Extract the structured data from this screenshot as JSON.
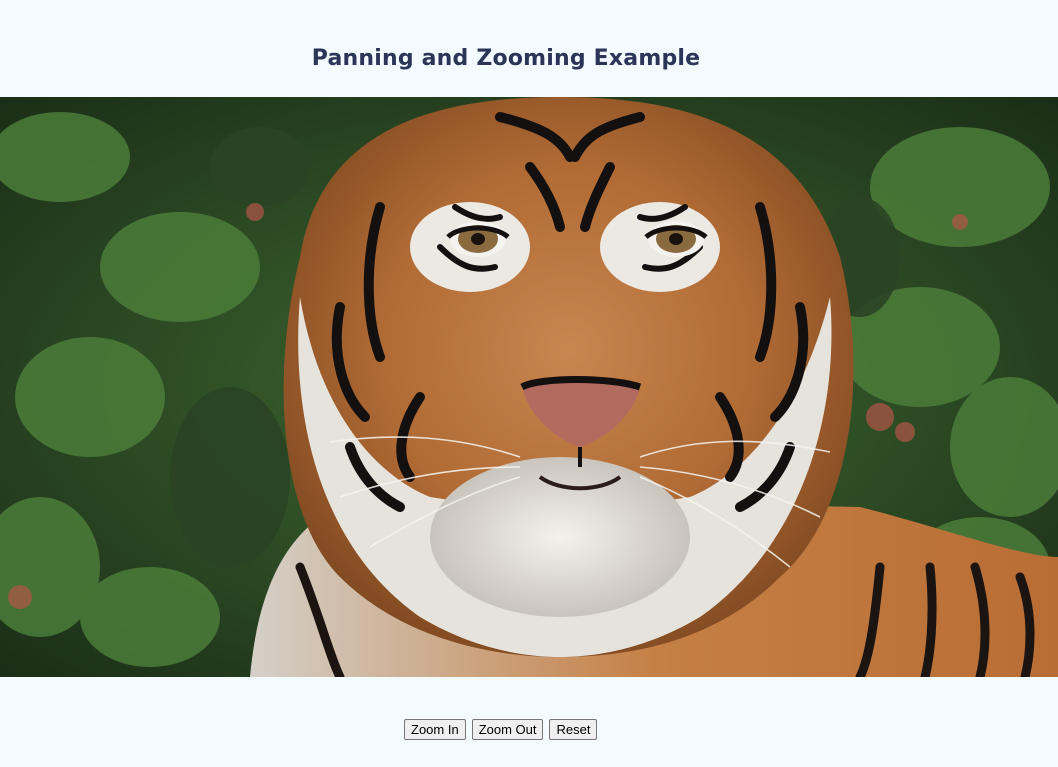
{
  "page": {
    "title": "Panning and Zooming Example"
  },
  "image": {
    "subject": "tiger-portrait"
  },
  "controls": {
    "zoom_in": "Zoom In",
    "zoom_out": "Zoom Out",
    "reset": "Reset"
  }
}
